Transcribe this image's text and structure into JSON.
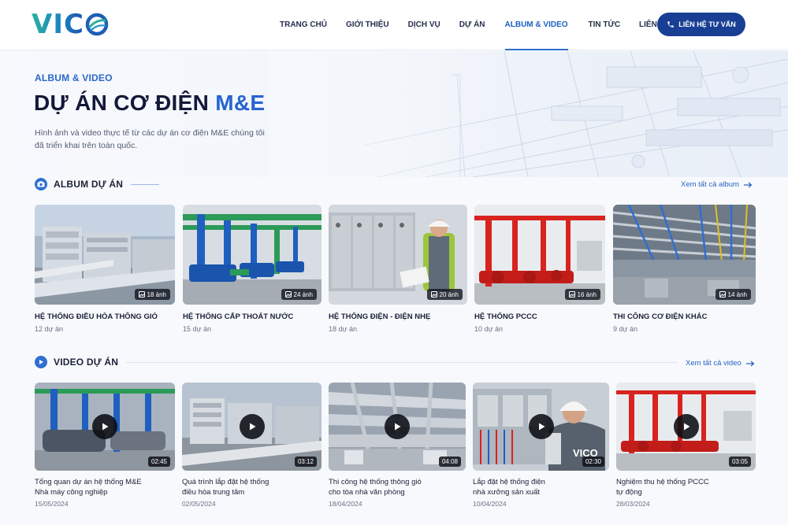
{
  "brand": {
    "logo_text": "VIC",
    "logo_mark": "globe-o-logo"
  },
  "nav": {
    "items": [
      "TRANG CHỦ",
      "GIỚI THIỆU",
      "DỊCH VỤ",
      "DỰ ÁN",
      "ALBUM & VIDEO",
      "TIN TỨC",
      "LIÊN HỆ"
    ],
    "active": "ALBUM & VIDEO",
    "cta_label": "LIÊN HỆ TƯ VẤN",
    "cta_icon": "phone-icon"
  },
  "hero": {
    "eyebrow": "ALBUM & VIDEO",
    "title_main": "DỰ ÁN CƠ ĐIỆN ",
    "title_accent": "M&E",
    "description": "Hình ảnh và video thực tế từ các dự án cơ điện M&E chúng tôi đã triển khai trên toàn quốc."
  },
  "albums": {
    "heading": "ALBUM DỰ ÁN",
    "heading_icon": "camera-icon",
    "see_all": "Xem tất cả album",
    "items": [
      {
        "title": "HỆ THỐNG ĐIỀU HÒA THÔNG GIÓ",
        "count": "12 dự án",
        "photos": "18 ảnh"
      },
      {
        "title": "HỆ THỐNG CẤP THOÁT NƯỚC",
        "count": "15 dự án",
        "photos": "24 ảnh"
      },
      {
        "title": "HỆ THỐNG ĐIỆN - ĐIỆN NHẸ",
        "count": "18 dự án",
        "photos": "20 ảnh"
      },
      {
        "title": "HỆ THỐNG PCCC",
        "count": "10 dự án",
        "photos": "16 ảnh"
      },
      {
        "title": "THI CÔNG CƠ ĐIỆN KHÁC",
        "count": "9 dự án",
        "photos": "14 ảnh"
      }
    ]
  },
  "videos": {
    "heading": "VIDEO DỰ ÁN",
    "heading_icon": "play-circle-icon",
    "see_all": "Xem tất cả video",
    "items": [
      {
        "title_line1": "Tổng quan dự án hệ thống M&E",
        "title_line2": "Nhà máy công nghiệp",
        "date": "15/05/2024",
        "duration": "02:45"
      },
      {
        "title_line1": "Quá trình lắp đặt hệ thống",
        "title_line2": "điều hòa trung tâm",
        "date": "02/05/2024",
        "duration": "03:12"
      },
      {
        "title_line1": "Thi công hệ thống thông gió",
        "title_line2": "cho tòa nhà văn phòng",
        "date": "18/04/2024",
        "duration": "04:08"
      },
      {
        "title_line1": "Lắp đặt hệ thống điện",
        "title_line2": "nhà xưởng sản xuất",
        "date": "10/04/2024",
        "duration": "02:30"
      },
      {
        "title_line1": "Nghiệm thu hệ thống PCCC",
        "title_line2": "tự động",
        "date": "28/03/2024",
        "duration": "03:05"
      }
    ]
  },
  "photo_text": {
    "vest_logo": "VICO"
  },
  "colors": {
    "primary": "#183f94",
    "accent": "#2f6fd1",
    "fire_red": "#d8231f",
    "pipe_blue": "#1f5fbf",
    "pipe_green": "#2c9a58"
  }
}
